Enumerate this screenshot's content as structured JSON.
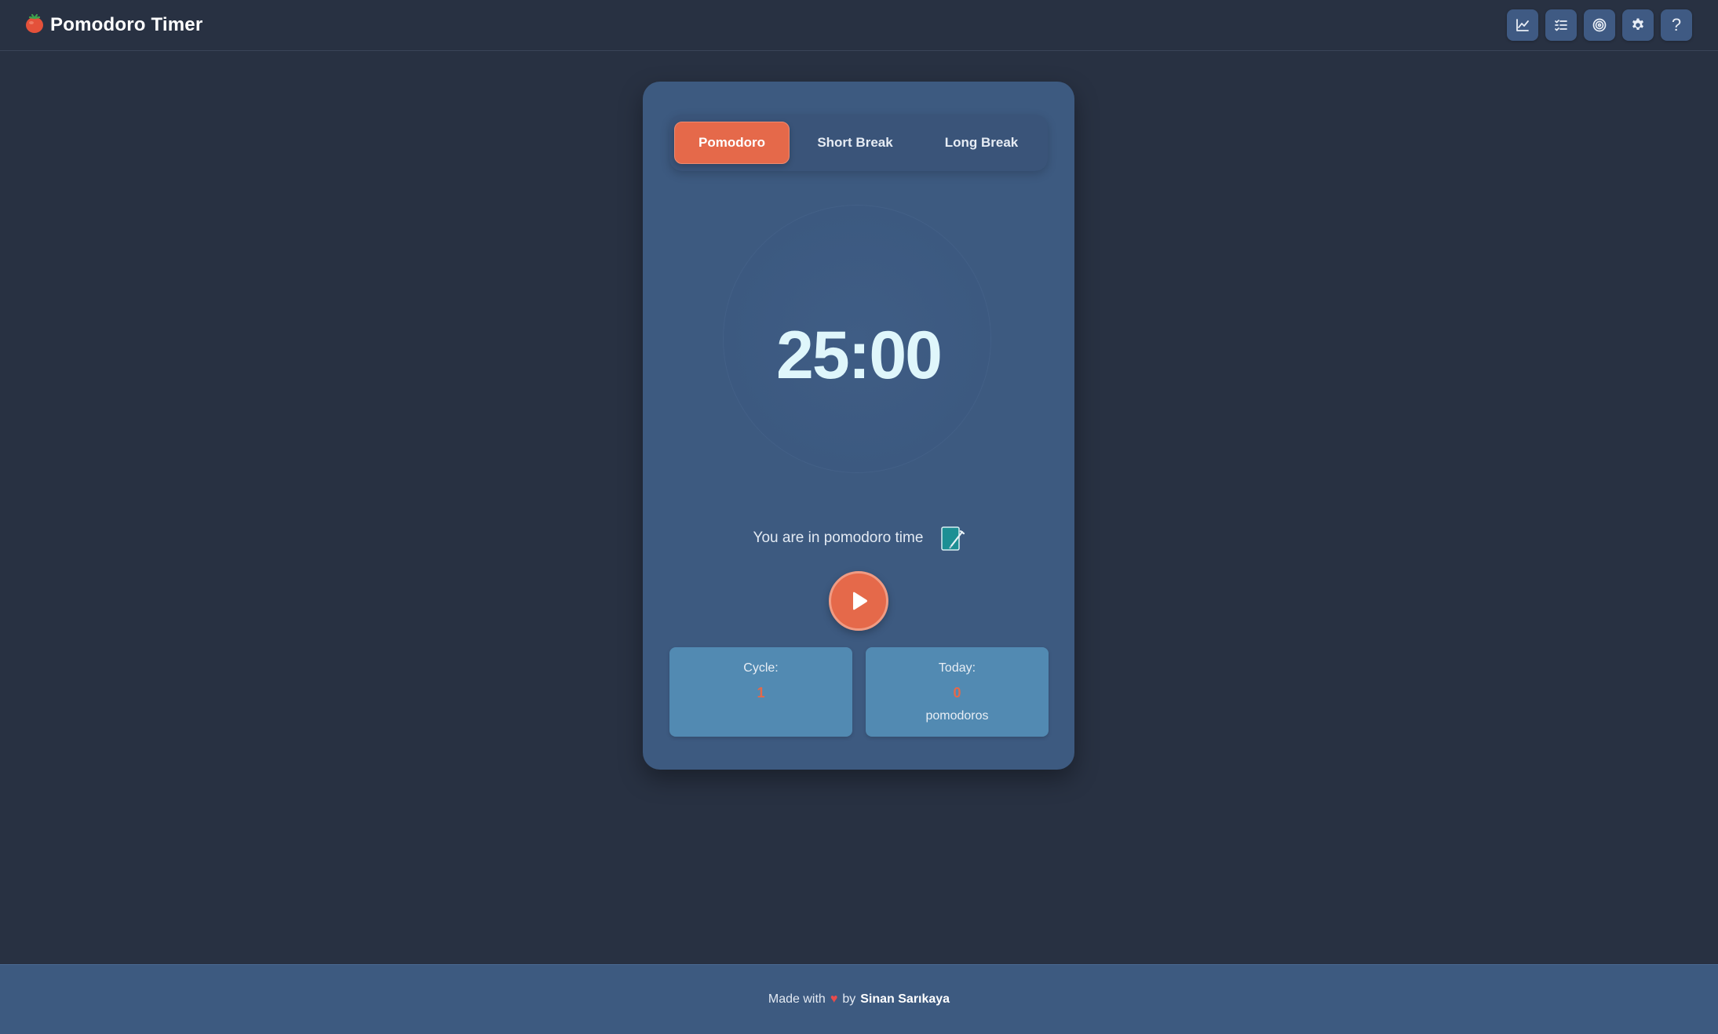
{
  "app": {
    "icon": "tomato-icon",
    "title": "Pomodoro Timer"
  },
  "toolbar": {
    "buttons": [
      {
        "name": "statistics",
        "icon": "line-chart-icon"
      },
      {
        "name": "tasks",
        "icon": "checklist-icon"
      },
      {
        "name": "goals",
        "icon": "target-icon"
      },
      {
        "name": "settings",
        "icon": "gear-icon"
      },
      {
        "name": "help",
        "icon": "question-icon",
        "label": "?"
      }
    ]
  },
  "modes": {
    "tabs": [
      {
        "label": "Pomodoro",
        "active": true
      },
      {
        "label": "Short Break",
        "active": false
      },
      {
        "label": "Long Break",
        "active": false
      }
    ]
  },
  "timer": {
    "display": "25:00",
    "status": "You are in pomodoro time"
  },
  "controls": {
    "play_icon": "play-icon",
    "edit_icon": "edit-note-icon"
  },
  "stats": {
    "cycle": {
      "label": "Cycle:",
      "value": "1"
    },
    "today": {
      "label": "Today:",
      "value": "0",
      "unit": "pomodoros"
    }
  },
  "footer": {
    "prefix": "Made with",
    "heart": "♥",
    "by": "by",
    "author": "Sinan Sarıkaya"
  },
  "colors": {
    "background": "#283142",
    "card": "#3d5a80",
    "accent": "#e5694a",
    "stat_box": "#528ab2",
    "timer_text": "#dff6fb"
  }
}
